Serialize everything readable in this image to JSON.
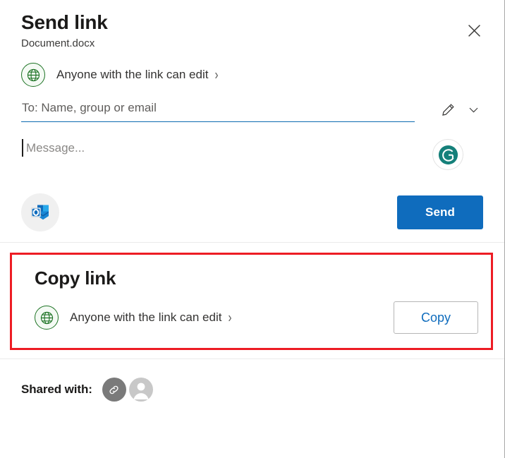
{
  "dialog": {
    "title": "Send link",
    "file_name": "Document.docx",
    "close_icon": "close-icon"
  },
  "send": {
    "permission": {
      "icon": "globe-icon",
      "label": "Anyone with the link can edit",
      "chevron": "›"
    },
    "to_field": {
      "placeholder": "To: Name, group or email",
      "value": "",
      "edit_icon": "pencil-icon",
      "expand_icon": "chevron-down-icon"
    },
    "message_field": {
      "placeholder": "Message...",
      "value": ""
    },
    "grammarly": {
      "icon": "grammarly-icon",
      "letter": "G",
      "color": "#15807a"
    },
    "outlook": {
      "icon": "outlook-icon",
      "letter": "O"
    },
    "send_button": {
      "label": "Send",
      "color": "#0f6cbd"
    }
  },
  "copy": {
    "title": "Copy link",
    "highlight_color": "#ed1c24",
    "permission": {
      "icon": "globe-icon",
      "label": "Anyone with the link can edit",
      "chevron": "›"
    },
    "copy_button": {
      "label": "Copy",
      "color": "#0f6cbd"
    }
  },
  "shared": {
    "label": "Shared with:",
    "avatars": [
      {
        "name": "link-avatar",
        "icon": "link-icon"
      },
      {
        "name": "person-avatar",
        "icon": "person-icon"
      }
    ]
  }
}
